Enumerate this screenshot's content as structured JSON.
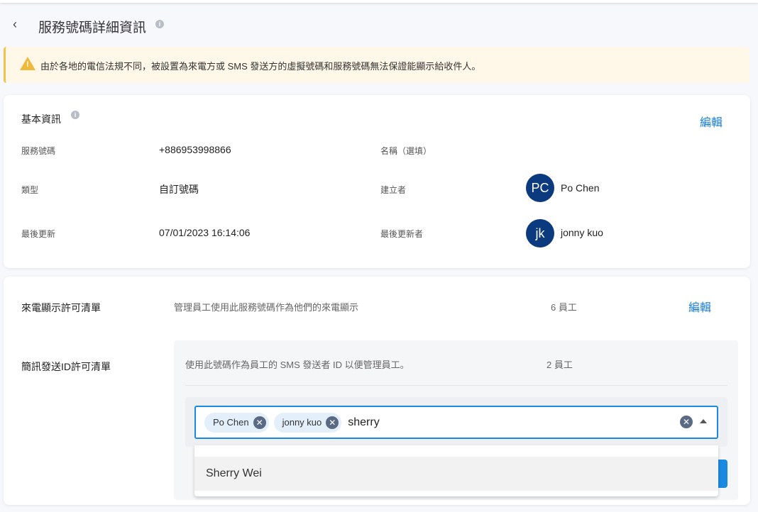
{
  "header": {
    "back_icon": "chevron-left",
    "title": "服務號碼詳細資訊"
  },
  "banner": {
    "text": "由於各地的電信法規不同，被設置為來電方或 SMS 發送方的虛擬號碼和服務號碼無法保證能顯示給收件人。",
    "icon": "warning-icon"
  },
  "basic": {
    "title": "基本資訊",
    "edit": "編輯",
    "service_number_label": "服務號碼",
    "service_number": "+886953998866",
    "name_label": "名稱（選填）",
    "type_label": "類型",
    "type": "自訂號碼",
    "creator_label": "建立者",
    "creator_initials": "PC",
    "creator": "Po Chen",
    "updated_label": "最後更新",
    "updated": "07/01/2023 16:14:06",
    "updater_label": "最後更新者",
    "updater_initials": "jk",
    "updater": "jonny kuo"
  },
  "allow": {
    "caller_label": "來電顯示許可清單",
    "caller_desc": "管理員工使用此服務號碼作為他們的來電顯示",
    "caller_count": "6 員工",
    "caller_edit": "編輯",
    "sms_label": "簡訊發送ID許可清單",
    "sms_desc": "使用此號碼作為員工的 SMS 發送者 ID 以便管理員工。",
    "sms_count": "2 員工",
    "chips": [
      "Po Chen",
      "jonny kuo"
    ],
    "input_value": "sherry",
    "options": [
      "Sherry Wei"
    ]
  },
  "colors": {
    "accent": "#1a7fd4",
    "avatar": "#0b3a7e",
    "warning": "#f0b93a"
  }
}
